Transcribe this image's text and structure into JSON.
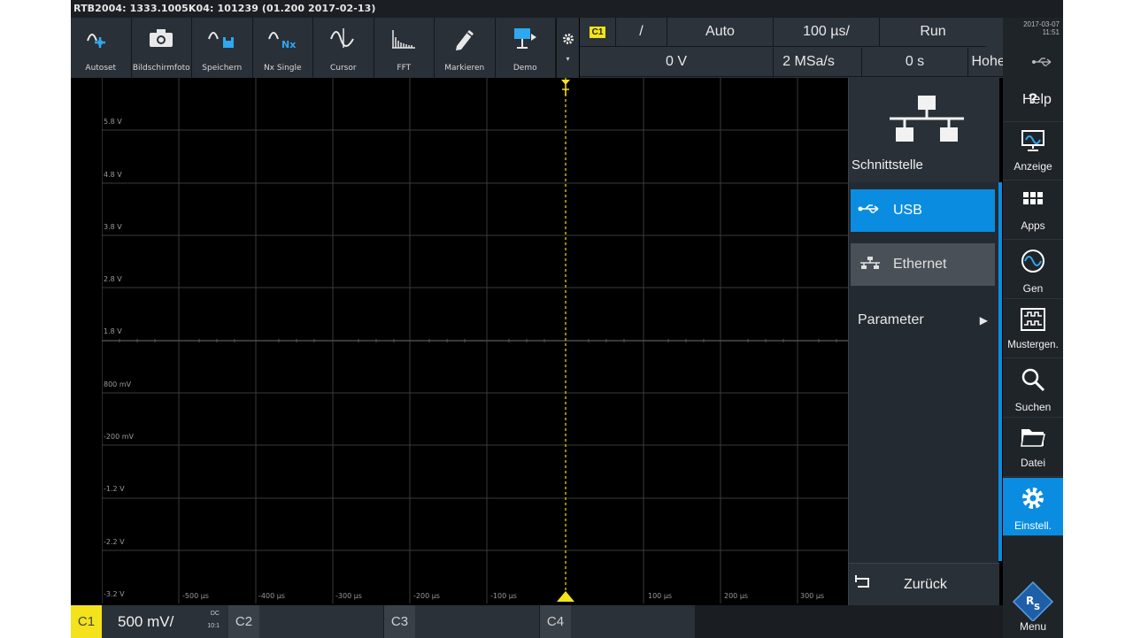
{
  "title_bar": "RTB2004: 1333.1005K04: 101239 (01.200 2017-02-13)",
  "toolbar": [
    {
      "id": "autoset",
      "label": "Autoset",
      "icon": "autoset-icon"
    },
    {
      "id": "screenshot",
      "label": "Bildschirmfoto",
      "icon": "camera-icon"
    },
    {
      "id": "save",
      "label": "Speichern",
      "icon": "save-waveform-icon"
    },
    {
      "id": "nx-single",
      "label": "Nx Single",
      "icon": "nx-single-icon"
    },
    {
      "id": "cursor",
      "label": "Cursor",
      "icon": "cursor-icon"
    },
    {
      "id": "fft",
      "label": "FFT",
      "icon": "fft-icon"
    },
    {
      "id": "mark",
      "label": "Markieren",
      "icon": "pencil-icon"
    },
    {
      "id": "demo",
      "label": "Demo",
      "icon": "demo-icon"
    }
  ],
  "trigger": {
    "channel": "C1",
    "slope": "/",
    "mode": "Auto",
    "timebase": "100 µs/",
    "run_state": "Run",
    "level": "0 V",
    "sample_rate": "2 MSa/s",
    "offset": "0 s",
    "acq_mode": "Hohe Auflösung"
  },
  "datetime": {
    "date": "2017-03-07",
    "time": "11:51"
  },
  "grid": {
    "y_labels": [
      "5.8 V",
      "4.8 V",
      "3.8 V",
      "2.8 V",
      "1.8 V",
      "800 mV",
      "-200 mV",
      "-1.2 V",
      "-2.2 V",
      "-3.2 V"
    ],
    "x_labels": [
      "-500 µs",
      "-400 µs",
      "-300 µs",
      "-200 µs",
      "-100 µs",
      "100 µs",
      "200 µs",
      "300 µs"
    ]
  },
  "panel": {
    "title": "Schnittstelle",
    "options": [
      {
        "label": "USB",
        "selected": true,
        "icon": "usb-icon"
      },
      {
        "label": "Ethernet",
        "selected": false,
        "icon": "ethernet-icon"
      },
      {
        "label": "Parameter",
        "selected": false,
        "icon": "chevron-right-icon"
      }
    ],
    "back_label": "Zurück"
  },
  "side_menu": [
    {
      "label": "Help",
      "icon": "help-icon"
    },
    {
      "label": "Anzeige",
      "icon": "display-icon"
    },
    {
      "label": "Apps",
      "icon": "apps-grid-icon"
    },
    {
      "label": "Gen",
      "icon": "generator-icon"
    },
    {
      "label": "Mustergen.",
      "icon": "pattern-generator-icon"
    },
    {
      "label": "Suchen",
      "icon": "search-icon"
    },
    {
      "label": "Datei",
      "icon": "folder-icon"
    },
    {
      "label": "Einstell.",
      "icon": "gear-icon",
      "active": true
    },
    {
      "label": "Menu",
      "icon": "rs-logo-icon"
    }
  ],
  "channels": [
    {
      "tag": "C1",
      "scale": "500 mV/",
      "coupling_top": "DC",
      "coupling_bottom": "10:1",
      "active": true
    },
    {
      "tag": "C2"
    },
    {
      "tag": "C3"
    },
    {
      "tag": "C4"
    }
  ],
  "colors": {
    "accent": "#0a8de0",
    "channel1": "#f3e21c",
    "background": "#000000"
  }
}
